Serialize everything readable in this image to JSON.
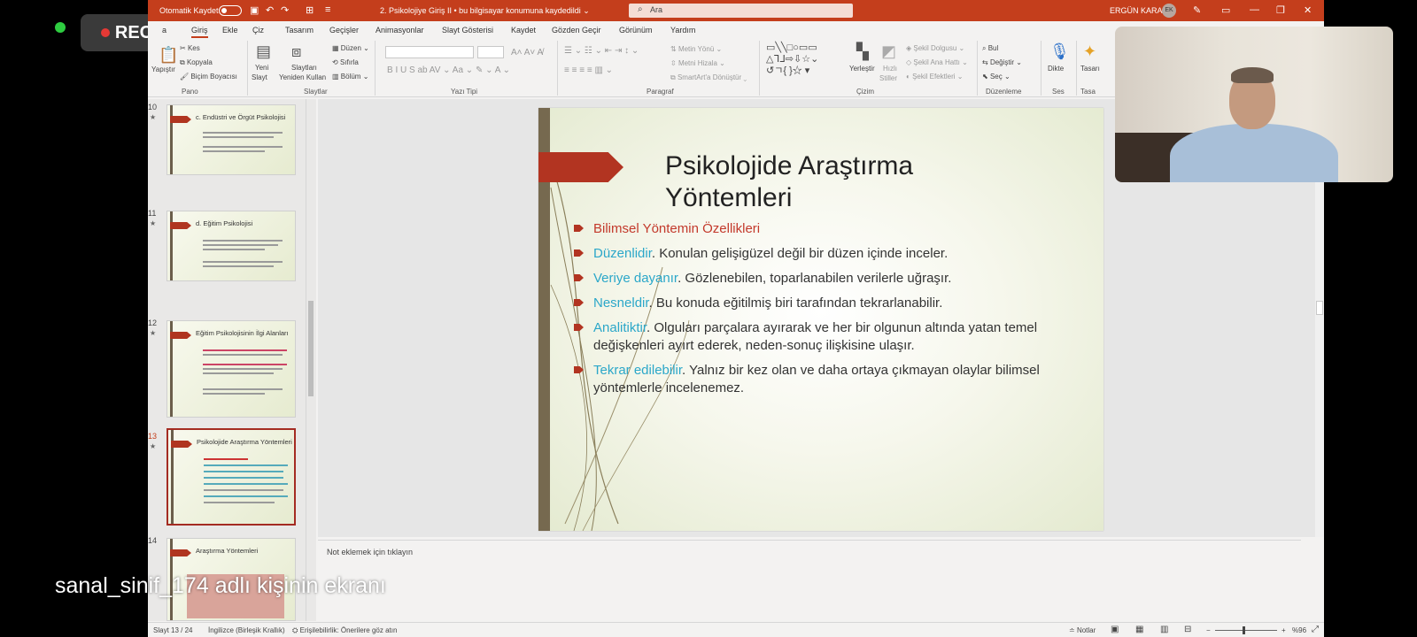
{
  "rec": {
    "label": "REC"
  },
  "titlebar": {
    "autosave": "Otomatik Kaydet",
    "doc_title": "2. Psikolojiye Giriş II  •  bu bilgisayar konumuna kaydedildi  ⌄",
    "search_placeholder": "Ara",
    "user": "ERGÜN KARA",
    "avatar_initials": "EK"
  },
  "menu": {
    "items": [
      "a",
      "Giriş",
      "Ekle",
      "Çiz",
      "Tasarım",
      "Geçişler",
      "Animasyonlar",
      "Slayt Gösterisi",
      "Kaydet",
      "Gözden Geçir",
      "Görünüm",
      "Yardım"
    ]
  },
  "ribbon": {
    "groups": [
      "Pano",
      "Slaytlar",
      "Yazı Tipi",
      "Paragraf",
      "Çizim",
      "Düzenleme",
      "Ses",
      "Tasa"
    ],
    "pano": {
      "paste": "Yapıştır",
      "cut": "Kes",
      "copy": "Kopyala",
      "format_painter": "Biçim Boyacısı"
    },
    "slaytlar": {
      "new_slide": "Yeni",
      "new_slide2": "Slayt",
      "reuse": "Slaytları",
      "reuse2": "Yeniden Kullan",
      "layout": "Düzen",
      "reset": "Sıfırla",
      "section": "Bölüm"
    },
    "paragraf": {
      "text_direction": "Metin Yönü",
      "align_text": "Metni Hizala",
      "smartart": "SmartArt'a Dönüştür"
    },
    "cizim": {
      "arrange": "Yerleştir",
      "quick_styles": "Hızlı",
      "quick_styles2": "Stiller",
      "fill": "Şekil Dolgusu",
      "outline": "Şekil Ana Hattı",
      "effects": "Şekil Efektleri"
    },
    "duzenleme": {
      "find": "Bul",
      "replace": "Değiştir",
      "select": "Seç"
    },
    "ses": {
      "dictate": "Dikte"
    },
    "tasarim": {
      "designer": "Tasarı"
    }
  },
  "thumbnails": [
    {
      "num": "10",
      "title": "c. Endüstri ve Örgüt Psikolojisi"
    },
    {
      "num": "11",
      "title": "d. Eğitim Psikolojisi"
    },
    {
      "num": "12",
      "title": "Eğitim Psikolojisinin İlgi Alanları"
    },
    {
      "num": "13",
      "title": "Psikolojide Araştırma Yöntemleri"
    },
    {
      "num": "14",
      "title": "Araştırma Yöntemleri"
    }
  ],
  "slide": {
    "title": "Psikolojide Araştırma Yöntemleri",
    "heading": "Bilimsel Yöntemin Özellikleri",
    "bullets": [
      {
        "key": "Düzenlidir",
        "text": ". Konulan gelişigüzel değil bir düzen içinde inceler."
      },
      {
        "key": "Veriye dayanır",
        "text": ". Gözlenebilen, toparlanabilen verilerle uğraşır."
      },
      {
        "key": "Nesneldir",
        "text": ". Bu konuda eğitilmiş biri tarafından tekrarlanabilir."
      },
      {
        "key": "Analitiktir",
        "text": ". Olguları parçalara ayırarak ve her bir olgunun altında yatan temel değişkenleri ayırt ederek, neden-sonuç ilişkisine ulaşır."
      },
      {
        "key": "Tekrar edilebilir",
        "text": ". Yalnız bir kez olan ve daha ortaya çıkmayan olaylar bilimsel yöntemlerle incelenemez."
      }
    ]
  },
  "notes": {
    "placeholder": "Not eklemek için tıklayın"
  },
  "statusbar": {
    "slide_count": "Slayt 13 / 24",
    "language": "İngilizce (Birleşik Krallık)",
    "accessibility": "Erişilebilirlik: Önerilere göz atın",
    "notes": "Notlar",
    "zoom": "%96"
  },
  "caption": {
    "text": "sanal_sinif_174 adlı kişinin ekranı"
  },
  "colors": {
    "accent": "#c43e1c",
    "link_blue": "#2ba7c9",
    "slide_red": "#b23421"
  }
}
